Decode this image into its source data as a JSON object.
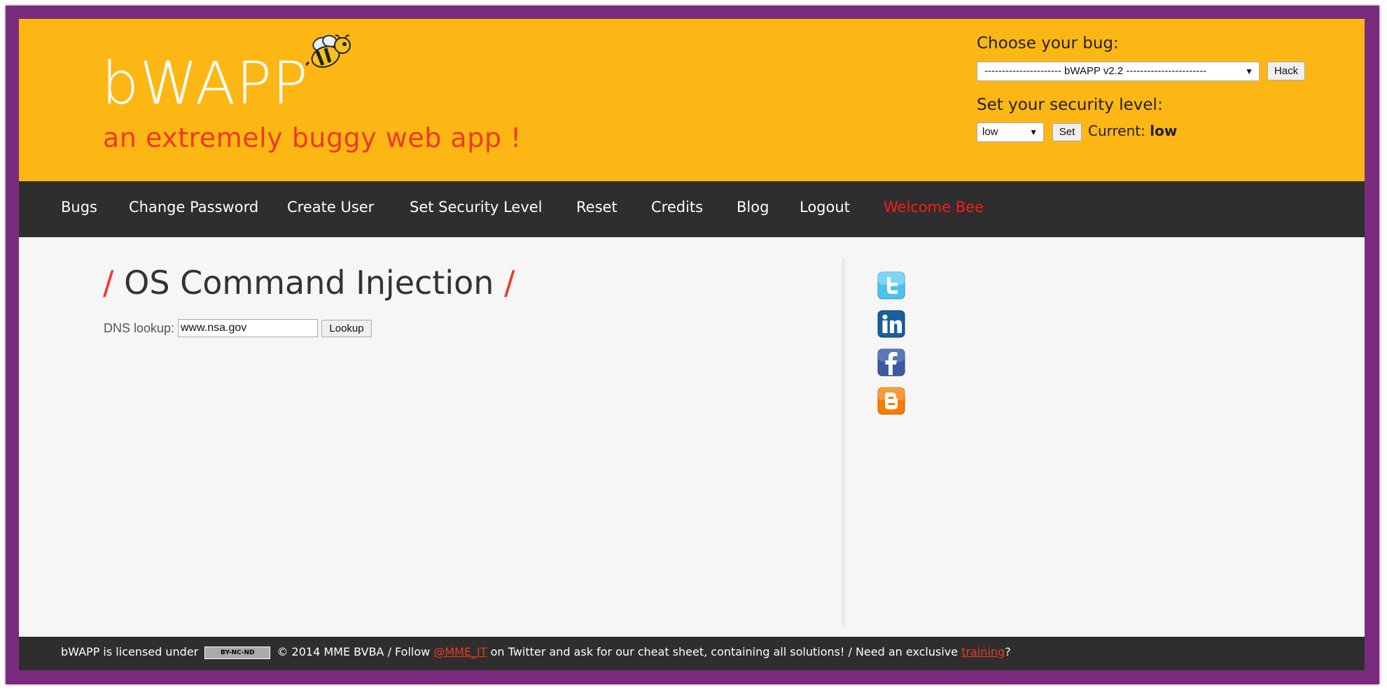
{
  "header": {
    "logo_text": "bWAPP",
    "tagline": "an extremely buggy web app !",
    "choose_bug_label": "Choose your bug:",
    "bug_selected": "---------------------- bWAPP v2.2 -----------------------",
    "hack_label": "Hack",
    "security_label": "Set your security level:",
    "security_selected": "low",
    "set_label": "Set",
    "current_label": "Current:",
    "current_value": "low"
  },
  "nav": {
    "items": [
      "Bugs",
      "Change Password",
      "Create User",
      "Set Security Level",
      "Reset",
      "Credits",
      "Blog",
      "Logout"
    ],
    "welcome": "Welcome Bee"
  },
  "main": {
    "title": "OS Command Injection",
    "title_slash": "/",
    "dns_label": "DNS lookup:",
    "dns_value": "www.nsa.gov",
    "lookup_label": "Lookup"
  },
  "social": [
    "twitter-icon",
    "linkedin-icon",
    "facebook-icon",
    "blogger-icon"
  ],
  "footer": {
    "text1": "bWAPP is licensed under",
    "cc_badge": "BY-NC-ND",
    "text2": "© 2014 MME BVBA / Follow",
    "twitter_link": "@MME_IT",
    "text3": "on Twitter and ask for our cheat sheet, containing all solutions! / Need an exclusive",
    "training_link": "training",
    "text4": "?"
  },
  "colors": {
    "header_bg": "#fdb714",
    "nav_bg": "#2e2e2e",
    "accent": "#ee3a23",
    "frame": "#7a2b7e"
  }
}
